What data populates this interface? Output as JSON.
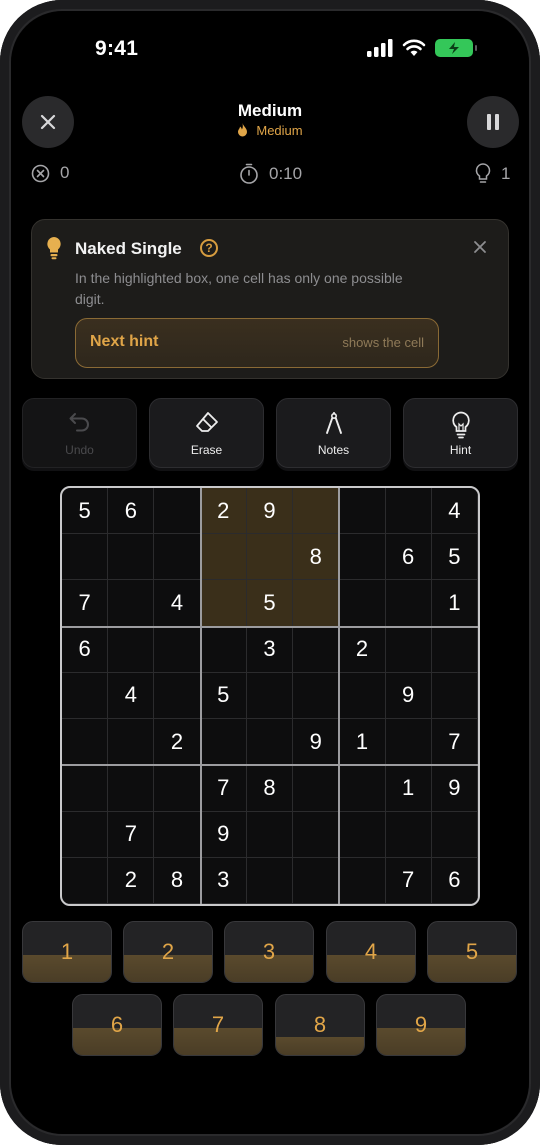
{
  "status_bar": {
    "time": "9:41"
  },
  "header": {
    "title": "Medium",
    "difficulty": "Medium",
    "mistakes": "0",
    "timer": "0:10",
    "hints_used": "1"
  },
  "hint_card": {
    "title": "Naked Single",
    "help_symbol": "?",
    "body": "In the highlighted box, one cell has only one possible digit.",
    "next_label": "Next hint",
    "next_sub": "shows the cell"
  },
  "tools": {
    "undo": "Undo",
    "erase": "Erase",
    "notes": "Notes",
    "hint": "Hint"
  },
  "board": {
    "rows": [
      [
        "5",
        "6",
        "",
        "2",
        "9",
        "",
        "",
        "",
        "4"
      ],
      [
        "",
        "",
        "",
        "",
        "",
        "8",
        "",
        "6",
        "5"
      ],
      [
        "7",
        "",
        "4",
        "",
        "5",
        "",
        "",
        "",
        "1"
      ],
      [
        "6",
        "",
        "",
        "",
        "3",
        "",
        "2",
        "",
        ""
      ],
      [
        "",
        "4",
        "",
        "5",
        "",
        "",
        "",
        "9",
        ""
      ],
      [
        "",
        "",
        "2",
        "",
        "",
        "9",
        "1",
        "",
        "7"
      ],
      [
        "",
        "",
        "",
        "7",
        "8",
        "",
        "",
        "1",
        "9"
      ],
      [
        "",
        "7",
        "",
        "9",
        "",
        "",
        "",
        "",
        ""
      ],
      [
        "",
        "2",
        "8",
        "3",
        "",
        "",
        "",
        "7",
        "6"
      ]
    ],
    "highlighted_box": "top-middle"
  },
  "number_pad": [
    {
      "label": "1",
      "progress": 0.45
    },
    {
      "label": "2",
      "progress": 0.45
    },
    {
      "label": "3",
      "progress": 0.45
    },
    {
      "label": "4",
      "progress": 0.45
    },
    {
      "label": "5",
      "progress": 0.45
    },
    {
      "label": "6",
      "progress": 0.45
    },
    {
      "label": "7",
      "progress": 0.45
    },
    {
      "label": "8",
      "progress": 0.3
    },
    {
      "label": "9",
      "progress": 0.45
    }
  ],
  "colors": {
    "accent": "#e0a548",
    "highlight": "#3a2f1a",
    "battery": "#34c759"
  },
  "icons": [
    "close-icon",
    "pause-icon",
    "mistakes-icon",
    "timer-icon",
    "bulb-icon",
    "help-icon",
    "undo-icon",
    "eraser-icon",
    "pencil-icon",
    "signal-icon",
    "wifi-icon",
    "battery-icon",
    "flame-icon"
  ]
}
